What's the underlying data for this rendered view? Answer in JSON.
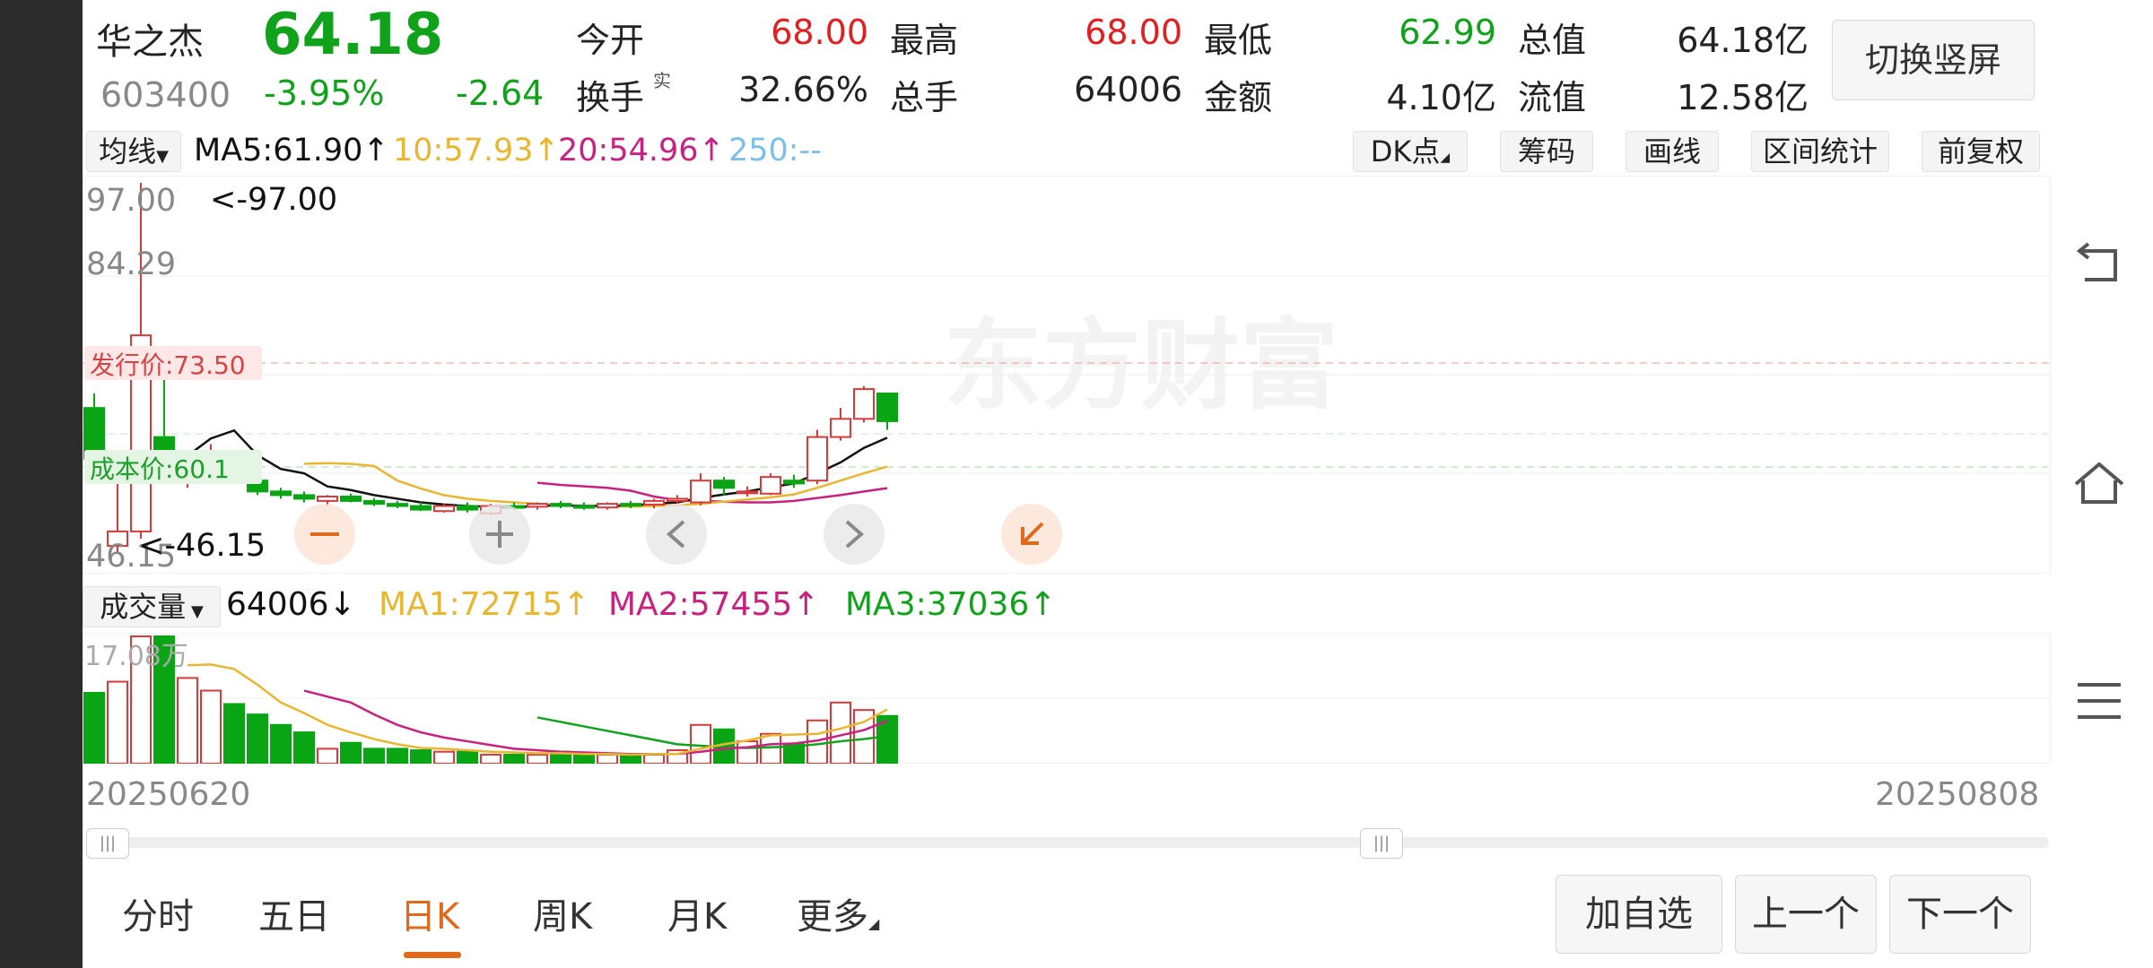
{
  "stock": {
    "name": "华之杰",
    "price": "64.18",
    "code": "603400",
    "change_pct": "-3.95%",
    "change": "-2.64"
  },
  "quote": {
    "open_label": "今开",
    "open": "68.00",
    "high_label": "最高",
    "high": "68.00",
    "low_label": "最低",
    "low": "62.99",
    "total_value_label": "总值",
    "total_value": "64.18亿",
    "turnover_label": "换手",
    "turnover_sup": "实",
    "turnover": "32.66%",
    "volume_label": "总手",
    "volume": "64006",
    "amount_label": "金额",
    "amount": "4.10亿",
    "float_value_label": "流值",
    "float_value": "12.58亿"
  },
  "switch_button": "切换竖屏",
  "ma_bar": {
    "selector": "均线",
    "ma5": "MA5:61.90↑",
    "ma10": "10:57.93↑",
    "ma20": "20:54.96↑",
    "ma250": "250:--"
  },
  "toolbar": {
    "dk": "DK点",
    "chips": "筹码",
    "draw": "画线",
    "range_stats": "区间统计",
    "adjust": "前复权"
  },
  "price_chart": {
    "y_max_label": "97.00",
    "y_mid_label": "84.29",
    "y_min_label": "46.15",
    "high_annotation": "<-97.00",
    "low_annotation": "<-46.15",
    "ipo_price_label": "发行价:73.50",
    "cost_label": "成本价:60.1",
    "watermark": "东方财富"
  },
  "vol_bar": {
    "selector": "成交量",
    "vol": "64006↓",
    "ma1": "MA1:72715↑",
    "ma2": "MA2:57455↑",
    "ma3": "MA3:37036↑",
    "max_label": "17.08万"
  },
  "dates": {
    "start": "20250620",
    "end": "20250808"
  },
  "tabs": [
    "分时",
    "五日",
    "日K",
    "周K",
    "月K",
    "更多"
  ],
  "active_tab": "日K",
  "bottom_buttons": {
    "add": "加自选",
    "prev": "上一个",
    "next": "下一个"
  },
  "colors": {
    "up": "#d63a3a",
    "down": "#0aa514",
    "ma5": "#111111",
    "ma10": "#e8b631",
    "ma20": "#c9217f",
    "ma250": "#7cc0ea",
    "accent": "#e06a1c"
  },
  "chart_data": {
    "type": "candlestick",
    "ylim": [
      46.15,
      97.0
    ],
    "candles": [
      {
        "o": 66,
        "h": 68,
        "l": 58,
        "c": 59
      },
      {
        "o": 47,
        "h": 58,
        "l": 46.15,
        "c": 49
      },
      {
        "o": 49,
        "h": 97.0,
        "l": 48,
        "c": 76
      },
      {
        "o": 62,
        "h": 70,
        "l": 59,
        "c": 60
      },
      {
        "o": 57,
        "h": 60,
        "l": 55,
        "c": 59.5
      },
      {
        "o": 57.5,
        "h": 61,
        "l": 56,
        "c": 59
      },
      {
        "o": 59,
        "h": 59.5,
        "l": 56,
        "c": 57
      },
      {
        "o": 56,
        "h": 56.5,
        "l": 54,
        "c": 54.5
      },
      {
        "o": 54.5,
        "h": 55,
        "l": 53.5,
        "c": 54
      },
      {
        "o": 54,
        "h": 54.5,
        "l": 53,
        "c": 53.5
      },
      {
        "o": 53.2,
        "h": 54,
        "l": 52.5,
        "c": 53.8
      },
      {
        "o": 53.8,
        "h": 54.2,
        "l": 53,
        "c": 53.2
      },
      {
        "o": 53.2,
        "h": 53.6,
        "l": 52.5,
        "c": 52.8
      },
      {
        "o": 52.8,
        "h": 53.2,
        "l": 52.2,
        "c": 52.5
      },
      {
        "o": 52.5,
        "h": 53,
        "l": 51.8,
        "c": 52
      },
      {
        "o": 51.8,
        "h": 52.8,
        "l": 51.6,
        "c": 52.5
      },
      {
        "o": 52.5,
        "h": 53,
        "l": 51.6,
        "c": 52
      },
      {
        "o": 51.5,
        "h": 52.8,
        "l": 51.2,
        "c": 52.5
      },
      {
        "o": 52.5,
        "h": 53,
        "l": 52,
        "c": 52.4
      },
      {
        "o": 52.4,
        "h": 53,
        "l": 52,
        "c": 52.8
      },
      {
        "o": 52.8,
        "h": 53.2,
        "l": 52.2,
        "c": 52.5
      },
      {
        "o": 52.5,
        "h": 53,
        "l": 52,
        "c": 52.3
      },
      {
        "o": 52.3,
        "h": 53,
        "l": 52,
        "c": 52.8
      },
      {
        "o": 52.8,
        "h": 53.2,
        "l": 52.2,
        "c": 52.7
      },
      {
        "o": 52.7,
        "h": 53.5,
        "l": 52.2,
        "c": 53.2
      },
      {
        "o": 53.2,
        "h": 54,
        "l": 52.8,
        "c": 53.5
      },
      {
        "o": 53.0,
        "h": 57,
        "l": 52.6,
        "c": 56
      },
      {
        "o": 56,
        "h": 56.5,
        "l": 54,
        "c": 55
      },
      {
        "o": 54.5,
        "h": 55.2,
        "l": 53.8,
        "c": 54.5
      },
      {
        "o": 54.2,
        "h": 57,
        "l": 54,
        "c": 56.5
      },
      {
        "o": 56,
        "h": 56.8,
        "l": 55,
        "c": 55.6
      },
      {
        "o": 56,
        "h": 63,
        "l": 55.5,
        "c": 62
      },
      {
        "o": 62,
        "h": 66,
        "l": 61.5,
        "c": 64.5
      },
      {
        "o": 64.5,
        "h": 69,
        "l": 64,
        "c": 68.6
      },
      {
        "o": 68,
        "h": 68,
        "l": 62.99,
        "c": 64.18
      }
    ],
    "volumes": [
      95000,
      110000,
      170800,
      170800,
      115000,
      98000,
      80000,
      66000,
      52000,
      42000,
      20000,
      28000,
      20000,
      20000,
      18000,
      16000,
      16000,
      12000,
      12000,
      12000,
      16000,
      12000,
      12000,
      10000,
      12000,
      18000,
      52000,
      46000,
      30000,
      40000,
      26000,
      58000,
      82000,
      72000,
      64006
    ],
    "ma_price": {
      "MA5": [
        null,
        null,
        null,
        null,
        59.4,
        61.8,
        62.9,
        59.5,
        57.6,
        57.0,
        55.2,
        54.7,
        54.0,
        53.5,
        53.0,
        52.7,
        52.5,
        52.4,
        52.3,
        52.5,
        52.6,
        52.5,
        52.5,
        52.6,
        52.8,
        53.0,
        53.6,
        54.1,
        54.5,
        55.1,
        55.6,
        57.0,
        58.5,
        60.5,
        61.9
      ],
      "MA10": [
        null,
        null,
        null,
        null,
        null,
        null,
        null,
        null,
        null,
        58.3,
        58.4,
        58.3,
        58.0,
        56.0,
        54.9,
        54.0,
        53.5,
        53.2,
        53.0,
        52.8,
        52.6,
        52.5,
        52.5,
        52.4,
        52.5,
        52.6,
        52.8,
        53.1,
        53.4,
        53.7,
        54.1,
        55.0,
        56.0,
        57.0,
        57.93
      ],
      "MA20": [
        null,
        null,
        null,
        null,
        null,
        null,
        null,
        null,
        null,
        null,
        null,
        null,
        null,
        null,
        null,
        null,
        null,
        null,
        null,
        55.7,
        55.4,
        55.2,
        55.0,
        54.6,
        53.8,
        53.3,
        53.2,
        53.1,
        53.0,
        53.0,
        53.2,
        53.6,
        54.0,
        54.5,
        54.96
      ]
    },
    "ma_vol": {
      "MA1": [
        null,
        null,
        null,
        null,
        132000,
        133000,
        127000,
        106000,
        82000,
        68000,
        52000,
        42000,
        33000,
        26000,
        21000,
        20000,
        18000,
        16000,
        15000,
        14000,
        14000,
        13000,
        13000,
        12000,
        13000,
        13000,
        20000,
        26000,
        31000,
        38000,
        39000,
        40000,
        47000,
        56000,
        72715
      ],
      "MA2": [
        null,
        null,
        null,
        null,
        null,
        null,
        null,
        null,
        null,
        98000,
        90000,
        82000,
        66000,
        52000,
        42000,
        35000,
        30000,
        25000,
        20000,
        18000,
        16000,
        15000,
        14000,
        13000,
        13000,
        13000,
        16000,
        20000,
        22000,
        26000,
        27000,
        31000,
        38000,
        45000,
        57455
      ],
      "MA3": [
        null,
        null,
        null,
        null,
        null,
        null,
        null,
        null,
        null,
        null,
        null,
        null,
        null,
        null,
        null,
        null,
        null,
        null,
        null,
        62000,
        56000,
        50000,
        44000,
        38000,
        32000,
        26000,
        24000,
        22000,
        21000,
        22000,
        23000,
        26000,
        30000,
        33000,
        37036
      ]
    }
  }
}
